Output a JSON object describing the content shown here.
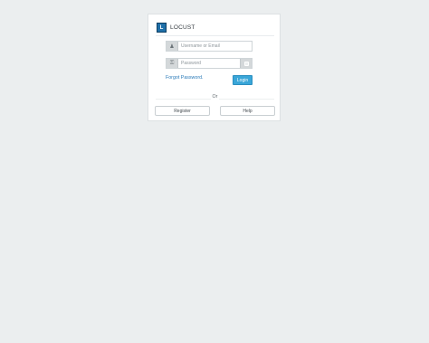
{
  "brand": {
    "logo_letter": "L",
    "name": "LOCUST"
  },
  "login_form": {
    "username": {
      "placeholder": "Username or Email",
      "value": "",
      "icon": "user-icon"
    },
    "password": {
      "placeholder": "Password",
      "value": "",
      "icon": "key-icon",
      "toggle_icon": "show-password-icon"
    },
    "forgot_label": "Forgot Password.",
    "login_label": "Login"
  },
  "divider_text": "Or",
  "actions": {
    "register_label": "Register",
    "help_label": "Help"
  },
  "colors": {
    "background": "#ebeeef",
    "accent": "#3aa6d8",
    "link": "#2a7ab8",
    "logo": "#1f6fa8"
  }
}
